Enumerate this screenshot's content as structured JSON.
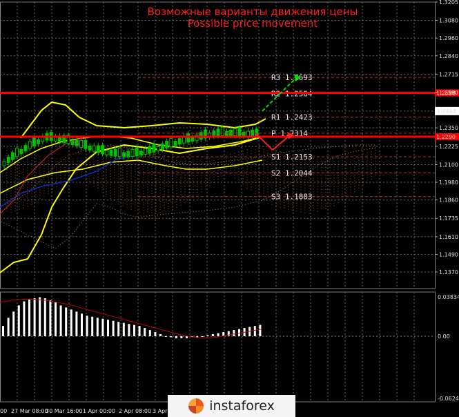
{
  "title": {
    "line1": "Возможные варианты движения цены",
    "line2": "Possible price movement"
  },
  "colors": {
    "background": "#000000",
    "price_level_lines": "#ff0000",
    "pivot_levels": "#c03030",
    "bollinger": "#ffff00",
    "ichimoku_cloud": "#d08a50",
    "candles": "#00c000",
    "macd_histogram": "#ffffff",
    "macd_signal": "#c00000",
    "bullish_arrow": "#00dd00",
    "bearish_arrow": "#ff2020"
  },
  "chart_data": [
    {
      "type": "line",
      "panel": "price",
      "y_ticks": [
        "1.3205",
        "1.3080",
        "1.2960",
        "1.2840",
        "1.2715",
        "1.2590",
        "1.2464",
        "1.2350",
        "1.2225",
        "1.2100",
        "1.1980",
        "1.1860",
        "1.1735",
        "1.1610",
        "1.1490",
        "1.1370"
      ],
      "ylim": [
        1.137,
        1.3205
      ],
      "x_ticks": [
        "00",
        "27 Mar 08:00",
        "30 Mar 16:00",
        "1 Apr 00:00",
        "2 Apr 08:00",
        "3 Apr"
      ],
      "current_price": "1.2464",
      "key_levels": [
        {
          "value": 1.2588,
          "label": "1.2588"
        },
        {
          "value": 1.229,
          "label": "1.2290"
        }
      ],
      "pivot_levels": [
        {
          "name": "R3",
          "value": 1.2693,
          "label": "R3  1.2693"
        },
        {
          "name": "R2",
          "value": 1.2584,
          "label": "R2  1.2584"
        },
        {
          "name": "R1",
          "value": 1.2423,
          "label": "R1  1.2423"
        },
        {
          "name": "P",
          "value": 1.2314,
          "label": "P  1.2314"
        },
        {
          "name": "S1",
          "value": 1.2153,
          "label": "S1  1.2153"
        },
        {
          "name": "S2",
          "value": 1.2044,
          "label": "S2  1.2044"
        },
        {
          "name": "S3",
          "value": 1.1883,
          "label": "S3  1.1883"
        }
      ],
      "scenarios": [
        {
          "direction": "up",
          "points": [
            1.2464,
            1.258,
            1.2693
          ]
        },
        {
          "direction": "down",
          "points": [
            1.2314,
            1.22,
            1.23
          ]
        }
      ]
    },
    {
      "type": "bar",
      "panel": "macd",
      "y_ticks": [
        "0.03834",
        "0.00",
        "-0.06247"
      ],
      "ylim": [
        -0.06247,
        0.03834
      ],
      "histogram": [
        0.01,
        0.018,
        0.024,
        0.03,
        0.034,
        0.036,
        0.037,
        0.038,
        0.037,
        0.035,
        0.033,
        0.03,
        0.028,
        0.026,
        0.024,
        0.022,
        0.02,
        0.019,
        0.018,
        0.017,
        0.016,
        0.015,
        0.014,
        0.013,
        0.012,
        0.011,
        0.01,
        0.008,
        0.006,
        0.004,
        0.002,
        0.0,
        -0.001,
        -0.002,
        -0.002,
        -0.002,
        -0.001,
        -0.001,
        0.0,
        0.001,
        0.002,
        0.003,
        0.004,
        0.005,
        0.006,
        0.007,
        0.008,
        0.009,
        0.01,
        0.011
      ],
      "signal": [
        0.033,
        0.035,
        0.036,
        0.036,
        0.035,
        0.033,
        0.031,
        0.028,
        0.025,
        0.022,
        0.019,
        0.016,
        0.013,
        0.01,
        0.007,
        0.004,
        0.001,
        -0.001,
        -0.002,
        -0.001,
        0.001,
        0.003,
        0.005,
        0.007
      ]
    }
  ],
  "logo": {
    "text": "instaforex"
  }
}
